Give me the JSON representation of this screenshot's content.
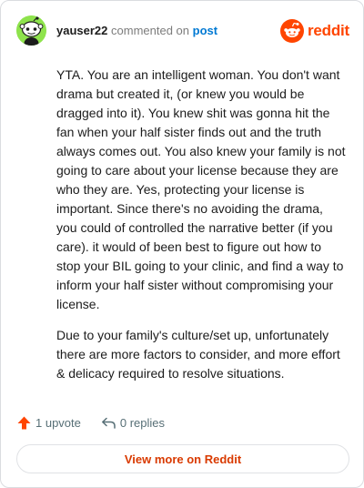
{
  "header": {
    "username": "yauser22",
    "action_text": "commented on",
    "post_link": "post",
    "brand_name": "reddit"
  },
  "comment": {
    "paragraphs": [
      "YTA. You are an intelligent woman. You don't want drama but created it, (or knew you would be dragged into it). You knew shit was gonna hit the fan when your half sister finds out and the truth always comes out. You also knew your family is not going to care about your license because they are who they are. Yes, protecting your license is important. Since there's no avoiding the drama, you could of controlled the narrative better (if you care). it would of been best to figure out how to stop your BIL going to your clinic, and find a way to inform your half sister without compromising your license.",
      "Due to your family's culture/set up, unfortunately there are more factors to consider, and more effort & delicacy required to resolve situations."
    ]
  },
  "actions": {
    "upvotes": "1 upvote",
    "replies": "0 replies"
  },
  "footer": {
    "view_more_label": "View more on Reddit"
  },
  "icons": {
    "avatar": "snoo-avatar-icon",
    "brand": "reddit-logo-icon",
    "upvote": "upvote-arrow-icon",
    "reply": "reply-arrow-icon"
  },
  "colors": {
    "brand": "#ff4500",
    "link": "#0079d3",
    "avatar_bg": "#8ee34c",
    "upvote": "#ff4500",
    "view_more_text": "#d93a00"
  }
}
